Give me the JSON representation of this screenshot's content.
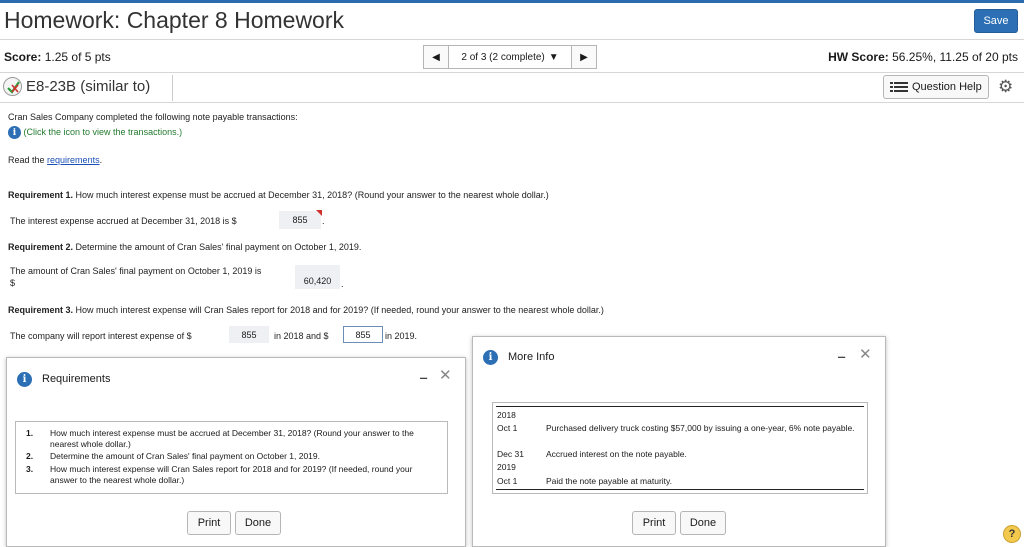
{
  "header": {
    "title": "Homework: Chapter 8 Homework",
    "save_label": "Save",
    "accent_color": "#2c6fb4"
  },
  "score_bar": {
    "score_label": "Score:",
    "score_value": "1.25 of 5 pts",
    "nav_status": "2 of 3 (2 complete)",
    "hw_score_label": "HW Score:",
    "hw_score_value": "56.25%, 11.25 of 20 pts"
  },
  "question": {
    "title": "E8-23B (similar to)",
    "help_label": "Question Help"
  },
  "body": {
    "intro": "Cran Sales Company completed the following note payable transactions:",
    "click_note": "(Click the icon to view the transactions.)",
    "read_prefix": "Read the",
    "read_link": "requirements",
    "read_suffix": ".",
    "req1_label": "Requirement 1.",
    "req1_text": "How much interest expense must be accrued at December 31, 2018? (Round your answer to the nearest whole dollar.)",
    "req1_answer_text": "The interest expense accrued at December 31, 2018 is $",
    "req1_value": "855",
    "req2_label": "Requirement 2.",
    "req2_text": "Determine the amount of Cran Sales' final payment on October 1, 2019.",
    "req2_answer_text": "The amount of Cran Sales' final payment on October 1, 2019 is",
    "req2_dollar": "$",
    "req2_value": "60,420",
    "req3_label": "Requirement 3.",
    "req3_text": "How much interest expense will Cran Sales report for 2018 and for 2019? (If needed, round your answer to the nearest whole dollar.)",
    "req3_answer_text": "The company will report interest expense of $",
    "req3_value1": "855",
    "req3_mid": "in 2018 and $",
    "req3_value2": "855",
    "req3_end": "in 2019.",
    "period": "."
  },
  "requirements_popup": {
    "title": "Requirements",
    "items": [
      {
        "num": "1.",
        "text": "How much interest expense must be accrued at December 31, 2018? (Round your answer to the nearest whole dollar.)"
      },
      {
        "num": "2.",
        "text": "Determine the amount of Cran Sales' final payment on October 1, 2019."
      },
      {
        "num": "3.",
        "text": "How much interest expense will Cran Sales report for 2018 and for 2019? (If needed, round your answer to the nearest whole dollar.)"
      }
    ],
    "print_label": "Print",
    "done_label": "Done"
  },
  "info_popup": {
    "title": "More Info",
    "year1": "2018",
    "date1": "Oct 1",
    "text1": "Purchased delivery truck costing $57,000 by issuing a one-year, 6% note payable.",
    "date2": "Dec 31",
    "text2": "Accrued interest on the note payable.",
    "year2": "2019",
    "date3": "Oct 1",
    "text3": "Paid the note payable at maturity.",
    "print_label": "Print",
    "done_label": "Done"
  },
  "icons": {
    "info": "i",
    "help": "?",
    "minimize": "‒",
    "close": "✕"
  }
}
